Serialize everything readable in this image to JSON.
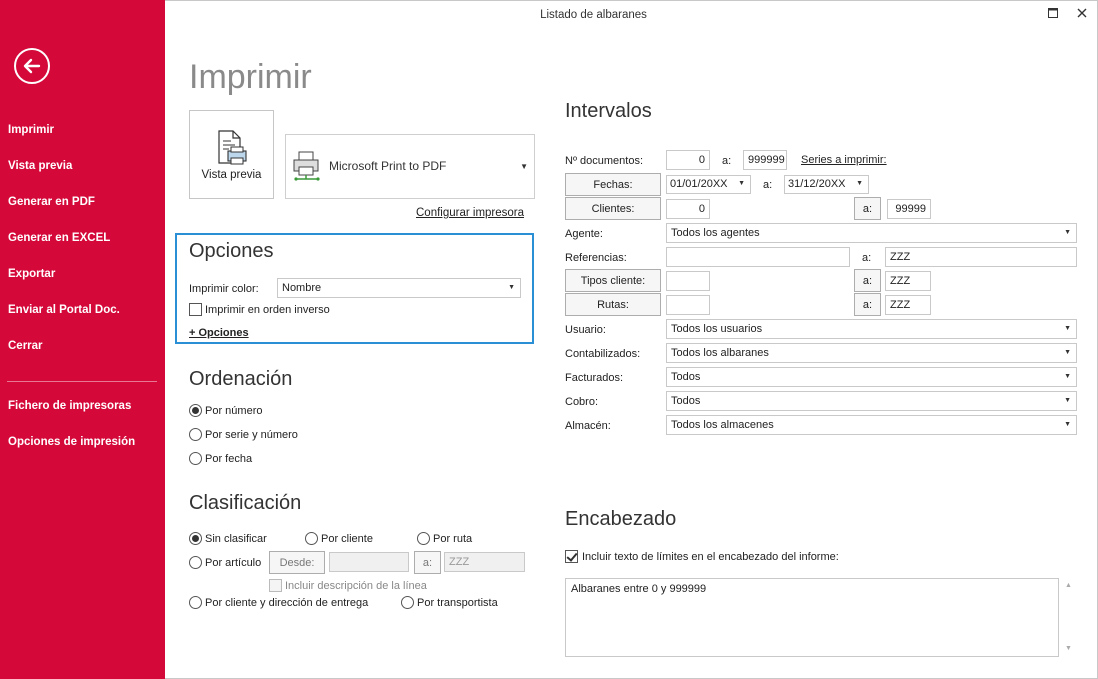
{
  "window": {
    "title": "Listado de albaranes"
  },
  "sidebar": {
    "items": [
      {
        "label": "Imprimir"
      },
      {
        "label": "Vista previa"
      },
      {
        "label": "Generar en PDF"
      },
      {
        "label": "Generar en EXCEL"
      },
      {
        "label": "Exportar"
      },
      {
        "label": "Enviar al Portal Doc."
      },
      {
        "label": "Cerrar"
      },
      {
        "label": "Fichero de impresoras"
      },
      {
        "label": "Opciones de impresión"
      }
    ],
    "color": "#d4093a"
  },
  "print": {
    "title": "Imprimir",
    "preview_label": "Vista previa",
    "printer_name": "Microsoft Print to PDF",
    "configure_link": "Configurar impresora"
  },
  "opciones": {
    "title": "Opciones",
    "color_label": "Imprimir color:",
    "color_value": "Nombre",
    "reverse_label": "Imprimir en orden inverso",
    "more_link": "+ Opciones",
    "accent": "#2b8fd6"
  },
  "ordenacion": {
    "title": "Ordenación",
    "options": [
      {
        "label": "Por número",
        "checked": true
      },
      {
        "label": "Por serie y número",
        "checked": false
      },
      {
        "label": "Por fecha",
        "checked": false
      }
    ]
  },
  "clasificacion": {
    "title": "Clasificación",
    "sin": "Sin clasificar",
    "cliente": "Por cliente",
    "ruta": "Por ruta",
    "articulo": "Por artículo",
    "desde_label": "Desde:",
    "a_label": "a:",
    "a_value": "ZZZ",
    "incluir_desc": "Incluir descripción de la línea",
    "cliente_dir": "Por cliente y dirección de entrega",
    "transportista": "Por transportista"
  },
  "intervalos": {
    "title": "Intervalos",
    "a": "a:",
    "num_docs": {
      "label": "Nº documentos:",
      "from": "0",
      "to": "999999",
      "series_link": "Series a imprimir:"
    },
    "fechas": {
      "label": "Fechas:",
      "from": "01/01/20XX",
      "to": "31/12/20XX"
    },
    "clientes": {
      "label": "Clientes:",
      "from": "0",
      "to": "99999"
    },
    "agente": {
      "label": "Agente:",
      "value": "Todos los agentes"
    },
    "referencias": {
      "label": "Referencias:",
      "from": "",
      "to": "ZZZ"
    },
    "tipos_cliente": {
      "label": "Tipos cliente:",
      "from": "",
      "to": "ZZZ"
    },
    "rutas": {
      "label": "Rutas:",
      "from": "",
      "to": "ZZZ"
    },
    "usuario": {
      "label": "Usuario:",
      "value": "Todos los usuarios"
    },
    "contabilizados": {
      "label": "Contabilizados:",
      "value": "Todos los albaranes"
    },
    "facturados": {
      "label": "Facturados:",
      "value": "Todos"
    },
    "cobro": {
      "label": "Cobro:",
      "value": "Todos"
    },
    "almacen": {
      "label": "Almacén:",
      "value": "Todos los almacenes"
    }
  },
  "encabezado": {
    "title": "Encabezado",
    "include_label": "Incluir texto de límites en el encabezado del informe:",
    "include_checked": true,
    "text": "Albaranes entre 0 y 999999"
  }
}
